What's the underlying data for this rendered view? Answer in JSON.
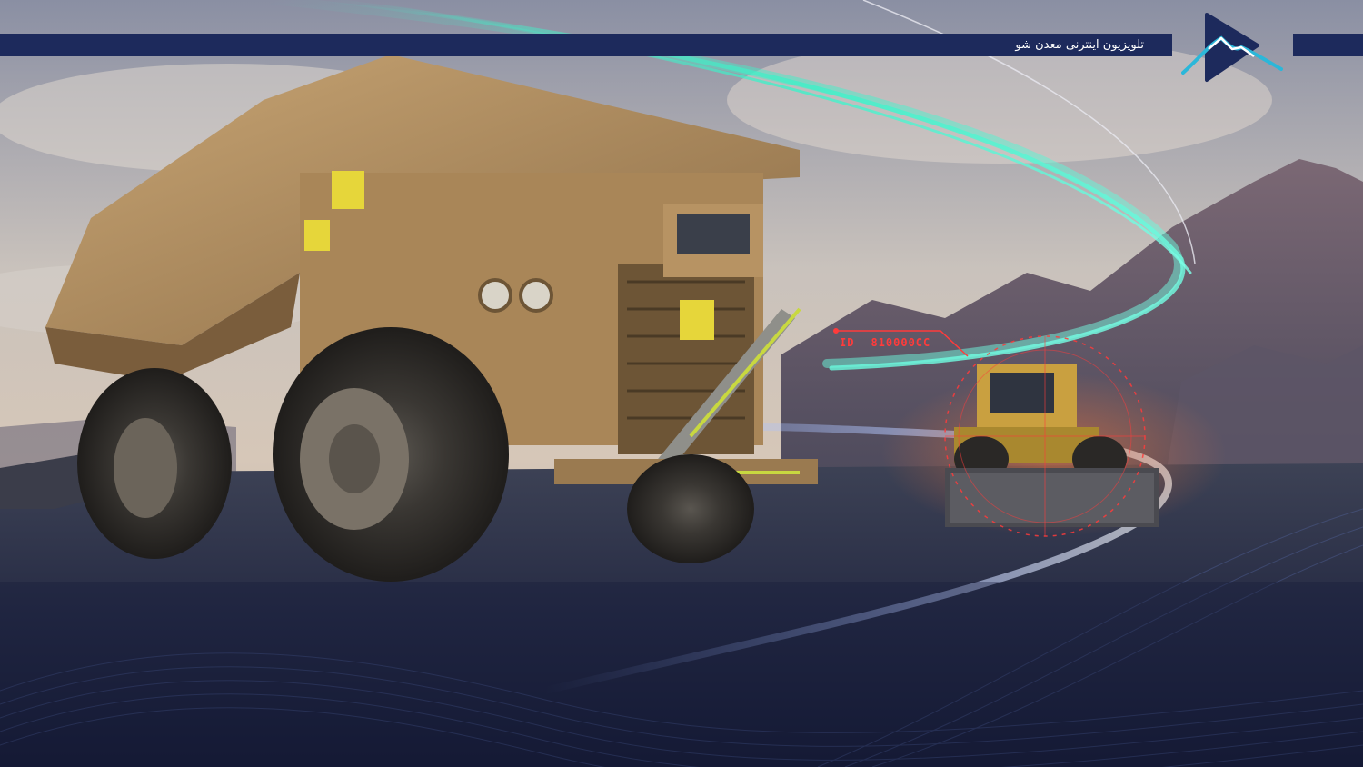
{
  "banner": {
    "title": "تلویزیون اینترنی معدن شو"
  },
  "target_overlay": {
    "id_prefix": "ID",
    "id_value": "810000CC",
    "color": "#ff3b3b"
  },
  "colors": {
    "banner": "#1d2a5c",
    "logo_dark": "#1d2a5c",
    "logo_accent": "#2bb7d9",
    "light_trail": "#3ff0c8"
  }
}
